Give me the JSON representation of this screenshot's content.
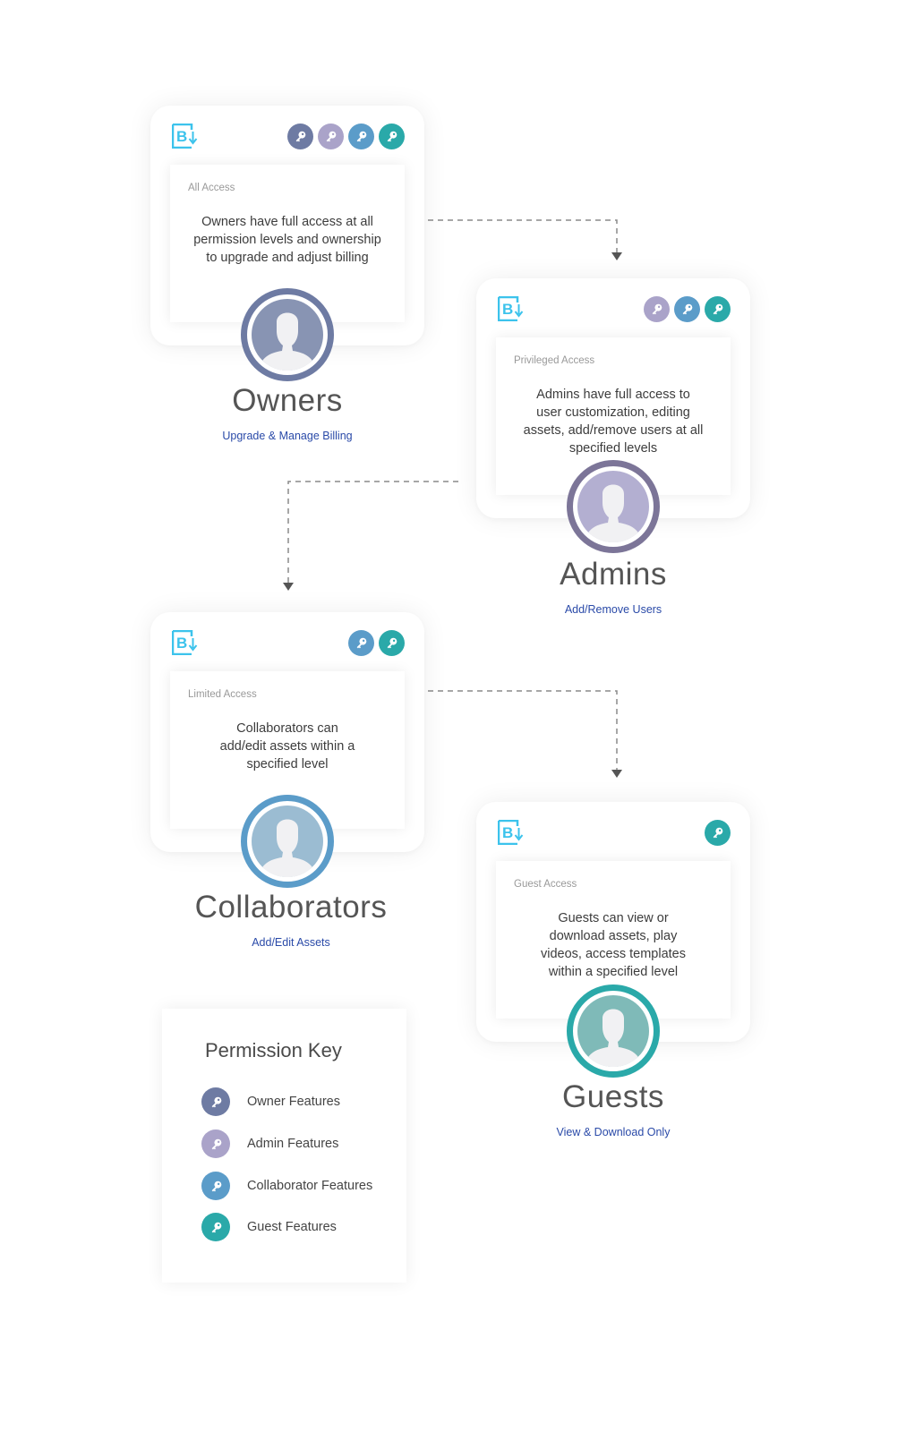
{
  "colors": {
    "owner": "#6e7ba3",
    "admin": "#aaa3c9",
    "collaborator": "#5b9cc9",
    "guest": "#2aa9a9",
    "logo": "#3cc3ec",
    "subtitle": "#2a4aa8",
    "connector": "#8a8a8a"
  },
  "roles": [
    {
      "id": "owners",
      "access_label": "All Access",
      "description": [
        "Owners have full access at all",
        "permission levels and ownership",
        "to upgrade and adjust billing"
      ],
      "title": "Owners",
      "subtitle": "Upgrade & Manage Billing",
      "keys": [
        "owner",
        "admin",
        "collaborator",
        "guest"
      ],
      "ring": "#6e7ba3",
      "face": "#8894b3"
    },
    {
      "id": "admins",
      "access_label": "Privileged Access",
      "description": [
        "Admins have full access to",
        "user customization, editing",
        "assets, add/remove users at all",
        "specified levels"
      ],
      "title": "Admins",
      "subtitle": "Add/Remove Users",
      "keys": [
        "admin",
        "collaborator",
        "guest"
      ],
      "ring": "#7c7598",
      "face": "#b3afd1"
    },
    {
      "id": "collaborators",
      "access_label": "Limited Access",
      "description": [
        "Collaborators can",
        "add/edit assets within a",
        "specified level"
      ],
      "title": "Collaborators",
      "subtitle": "Add/Edit Assets",
      "keys": [
        "collaborator",
        "guest"
      ],
      "ring": "#5b9cc9",
      "face": "#9bbcd2"
    },
    {
      "id": "guests",
      "access_label": "Guest Access",
      "description": [
        "Guests can view or",
        "download assets, play",
        "videos, access templates",
        "within a specified level"
      ],
      "title": "Guests",
      "subtitle": "View & Download Only",
      "keys": [
        "guest"
      ],
      "ring": "#2aa9a9",
      "face": "#7fbab8"
    }
  ],
  "legend": {
    "title": "Permission Key",
    "items": [
      {
        "key": "owner",
        "label": "Owner Features"
      },
      {
        "key": "admin",
        "label": "Admin Features"
      },
      {
        "key": "collaborator",
        "label": "Collaborator Features"
      },
      {
        "key": "guest",
        "label": "Guest Features"
      }
    ]
  }
}
